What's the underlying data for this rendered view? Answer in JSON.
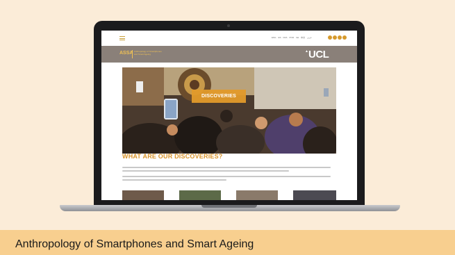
{
  "site": {
    "logo_text": "ASSA",
    "logo_subtitle": "Anthropology of Smartphones and Smart Ageing",
    "ucl_text": "UCL",
    "languages": [
      "ENG",
      "ES",
      "FRA",
      "POR",
      "Ital",
      "中文",
      "عربي"
    ],
    "hero_button_label": "DISCOVERIES",
    "section_heading": "WHAT ARE OUR DISCOVERIES?",
    "colors": {
      "accent": "#d8932a",
      "header_band": "#8a8079",
      "social_dot": "#d69a2d"
    }
  },
  "caption": "Anthropology of Smartphones and Smart Ageing"
}
